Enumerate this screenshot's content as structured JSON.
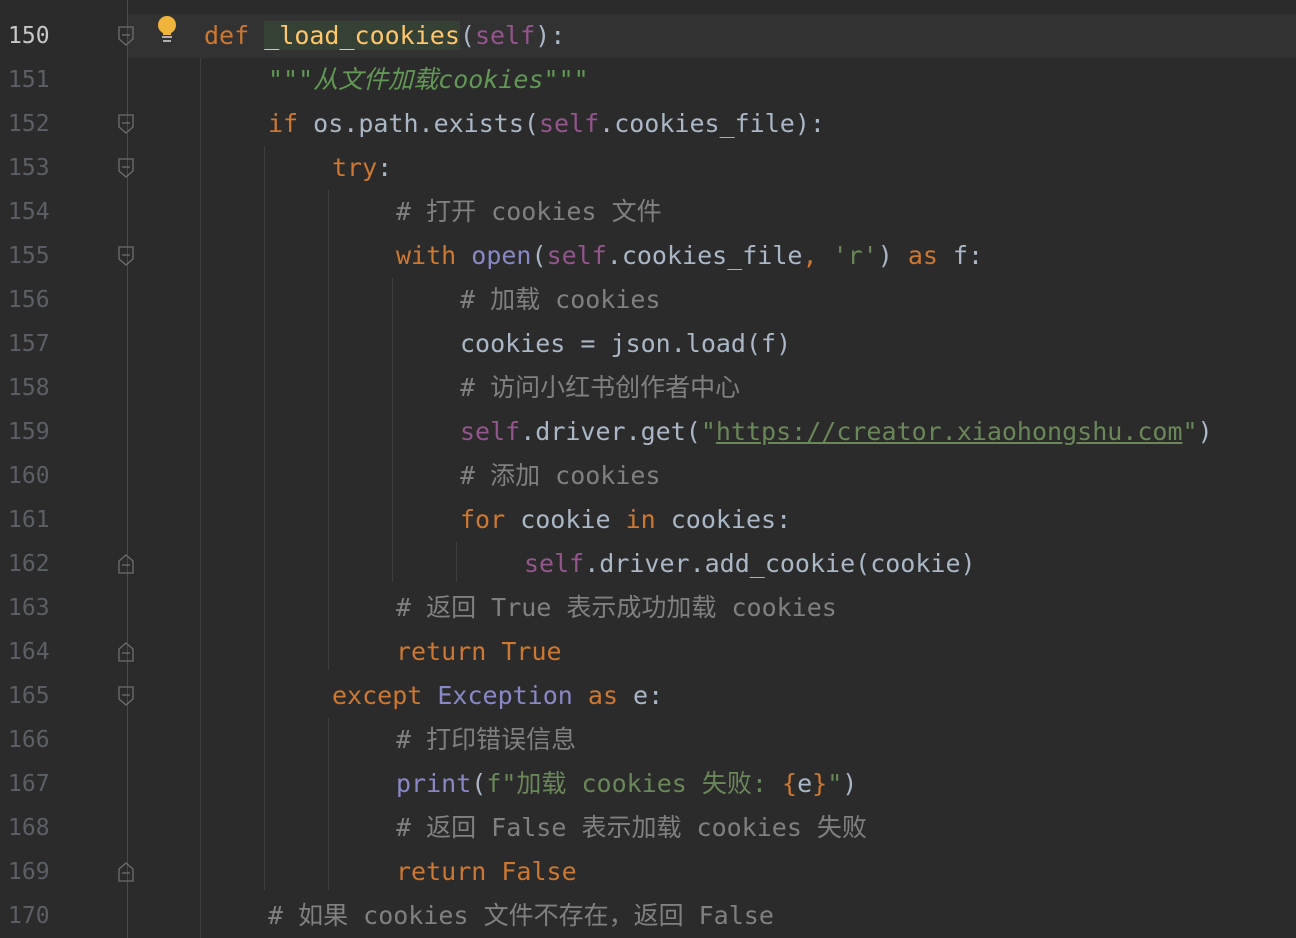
{
  "line_numbers": [
    "150",
    "151",
    "152",
    "153",
    "154",
    "155",
    "156",
    "157",
    "158",
    "159",
    "160",
    "161",
    "162",
    "163",
    "164",
    "165",
    "166",
    "167",
    "168",
    "169",
    "170"
  ],
  "code": {
    "l150": {
      "def": "def",
      "name": "_load_cookies",
      "open": "(",
      "self": "self",
      "close": "):"
    },
    "l151": {
      "doc": "\"\"\"从文件加载cookies\"\"\""
    },
    "l152": {
      "if": "if",
      "expr": " os.path.exists(",
      "self": "self",
      "rest": ".cookies_file):"
    },
    "l153": {
      "try": "try",
      "colon": ":"
    },
    "l154": {
      "comment": "# 打开 cookies 文件"
    },
    "l155": {
      "with": "with",
      "open": "open",
      "p1": "(",
      "self": "self",
      "rest": ".cookies_file",
      "comma": ",",
      "str": "'r'",
      "p2": ") ",
      "as": "as",
      "f": " f:"
    },
    "l156": {
      "comment": "# 加载 cookies"
    },
    "l157": {
      "text": "cookies = json.load(f)"
    },
    "l158": {
      "comment": "# 访问小红书创作者中心"
    },
    "l159": {
      "self": "self",
      "call": ".driver.get(",
      "q1": "\"",
      "url": "https://creator.xiaohongshu.com",
      "q2": "\"",
      "close": ")"
    },
    "l160": {
      "comment": "# 添加 cookies"
    },
    "l161": {
      "for": "for",
      "v": " cookie ",
      "in": "in",
      "rest": " cookies:"
    },
    "l162": {
      "self": "self",
      "rest": ".driver.add_cookie(cookie)"
    },
    "l163": {
      "comment": "# 返回 True 表示成功加载 cookies"
    },
    "l164": {
      "return": "return",
      "val": " True"
    },
    "l165": {
      "except": "except",
      "exc": " Exception ",
      "as": "as",
      "e": " e:"
    },
    "l166": {
      "comment": "# 打印错误信息"
    },
    "l167": {
      "print": "print",
      "p1": "(",
      "fpre": "f\"加载 cookies 失败: ",
      "ob": "{",
      "e": "e",
      "cb": "}",
      "q": "\"",
      "p2": ")"
    },
    "l168": {
      "comment": "# 返回 False 表示加载 cookies 失败"
    },
    "l169": {
      "return": "return",
      "val": " False"
    },
    "l170": {
      "comment": "# 如果 cookies 文件不存在，返回 False"
    }
  },
  "icons": {
    "intention": "lightbulb-icon",
    "fold_open": "fold-open-icon",
    "fold_close": "fold-close-icon"
  },
  "colors": {
    "background": "#2b2b2b",
    "keyword": "#cc7832",
    "function": "#ffc66d",
    "self": "#94558d",
    "string": "#6a8759",
    "comment": "#808080",
    "builtin": "#8888c6",
    "text": "#a9b7c6"
  }
}
